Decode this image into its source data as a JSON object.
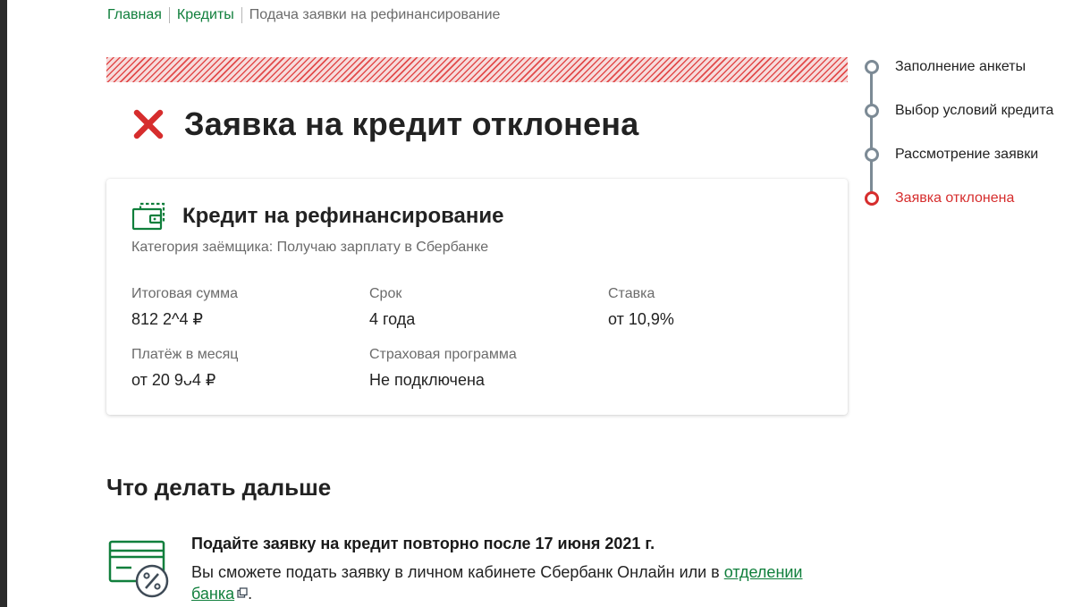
{
  "breadcrumb": {
    "home": "Главная",
    "credits": "Кредиты",
    "current": "Подача заявки на рефинансирование"
  },
  "status": {
    "title": "Заявка на кредит отклонена",
    "icon": "close-icon",
    "color": "#d62d2d"
  },
  "card": {
    "title": "Кредит на рефинансирование",
    "subtitle": "Категория заёмщика: Получаю зарплату в Сбербанке",
    "fields": {
      "total": {
        "label": "Итоговая сумма",
        "value": "812 2^4 ₽"
      },
      "term": {
        "label": "Срок",
        "value": "4 года"
      },
      "rate": {
        "label": "Ставка",
        "value": "от 10,9%"
      },
      "monthly": {
        "label": "Платёж в месяц",
        "value": "от 20 9ᴗ4 ₽"
      },
      "insurance": {
        "label": "Страховая программа",
        "value": "Не подключена"
      }
    }
  },
  "next": {
    "title": "Что делать дальше",
    "item": {
      "heading": "Подайте заявку на кредит повторно после 17 июня 2021 г.",
      "body_prefix": "Вы сможете подать заявку в личном кабинете Сбербанк Онлайн или в ",
      "link": "отделении банка",
      "body_suffix": "."
    }
  },
  "steps": [
    {
      "label": "Заполнение анкеты",
      "state": "done"
    },
    {
      "label": "Выбор условий кредита",
      "state": "done"
    },
    {
      "label": "Рассмотрение заявки",
      "state": "done"
    },
    {
      "label": "Заявка отклонена",
      "state": "rejected"
    }
  ],
  "colors": {
    "brand_green": "#107f3c",
    "error_red": "#d62d2d",
    "muted_text": "#6b6b6b",
    "step_gray": "#7c8a95"
  }
}
